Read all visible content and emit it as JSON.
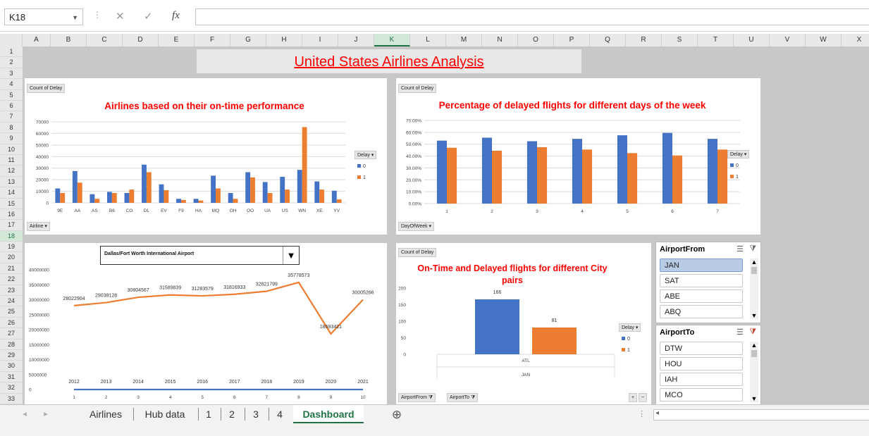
{
  "formula_bar": {
    "name_box": "K18",
    "fx_label": "fx",
    "formula_value": ""
  },
  "columns": [
    "A",
    "B",
    "C",
    "D",
    "E",
    "F",
    "G",
    "H",
    "I",
    "J",
    "K",
    "L",
    "M",
    "N",
    "O",
    "P",
    "Q",
    "R",
    "S",
    "T",
    "U",
    "V",
    "W",
    "X"
  ],
  "selected_column": "K",
  "rows": [
    "1",
    "2",
    "3",
    "4",
    "5",
    "6",
    "7",
    "8",
    "9",
    "10",
    "11",
    "12",
    "13",
    "14",
    "15",
    "16",
    "17",
    "18",
    "19",
    "20",
    "21",
    "22",
    "23",
    "24",
    "25",
    "26",
    "27",
    "28",
    "29",
    "30",
    "31",
    "32",
    "33"
  ],
  "selected_row": "18",
  "dashboard_title": "United States Airlines Analysis",
  "colors": {
    "series_0": "#4472c4",
    "series_1": "#ed7d31",
    "title_red": "#ff0000",
    "excel_green": "#217346"
  },
  "chart1": {
    "field_value": "Count of Delay",
    "field_axis": "Airline",
    "legend_title": "Delay",
    "legend": [
      "0",
      "1"
    ]
  },
  "chart2": {
    "field_value": "Count of Delay",
    "field_axis": "DayOfWeek",
    "legend_title": "Delay",
    "legend": [
      "0",
      "1"
    ]
  },
  "chart3": {
    "dropdown_value": "Dallas/Fort Worth International Airport"
  },
  "chart4": {
    "field_value": "Count of Delay",
    "legend_title": "Delay",
    "legend": [
      "0",
      "1"
    ],
    "filter_from": "AirportFrom",
    "filter_to": "AirportTo",
    "plus": "+",
    "minus": "−"
  },
  "chart_data": [
    {
      "type": "bar",
      "title": "Airlines based on their on-time performance",
      "categories": [
        "9E",
        "AA",
        "AS",
        "B6",
        "CO",
        "DL",
        "EV",
        "F9",
        "HA",
        "MQ",
        "OH",
        "OO",
        "UA",
        "US",
        "WN",
        "XE",
        "YV"
      ],
      "series": [
        {
          "name": "0",
          "values": [
            12500,
            27500,
            7500,
            9500,
            8500,
            33000,
            16000,
            3500,
            3500,
            23500,
            8500,
            26500,
            18000,
            22500,
            28500,
            18500,
            10500
          ]
        },
        {
          "name": "1",
          "values": [
            8500,
            17500,
            3500,
            8500,
            11500,
            26500,
            11000,
            2500,
            2000,
            12500,
            3500,
            22000,
            8500,
            11500,
            65500,
            11500,
            3000
          ]
        }
      ],
      "y_ticks": [
        "0",
        "10000",
        "20000",
        "30000",
        "40000",
        "50000",
        "60000",
        "70000"
      ],
      "ylim": [
        0,
        70000
      ]
    },
    {
      "type": "bar",
      "title": "Percentage of delayed flights for different days of the week",
      "categories": [
        "1",
        "2",
        "3",
        "4",
        "5",
        "6",
        "7"
      ],
      "series": [
        {
          "name": "0",
          "values": [
            0.53,
            0.555,
            0.525,
            0.545,
            0.575,
            0.595,
            0.545
          ]
        },
        {
          "name": "1",
          "values": [
            0.47,
            0.445,
            0.475,
            0.455,
            0.425,
            0.405,
            0.455
          ]
        }
      ],
      "y_ticks": [
        "0.00%",
        "10.00%",
        "20.00%",
        "30.00%",
        "40.00%",
        "50.00%",
        "60.00%",
        "70.00%"
      ],
      "ylim": [
        0,
        0.7
      ]
    },
    {
      "type": "line",
      "title": "",
      "x": [
        "1",
        "2",
        "3",
        "4",
        "5",
        "6",
        "7",
        "8",
        "9",
        "10"
      ],
      "series": [
        {
          "name": "Year",
          "values": [
            2012,
            2013,
            2014,
            2015,
            2016,
            2017,
            2018,
            2019,
            2020,
            2021
          ],
          "labels": [
            "2012",
            "2013",
            "2014",
            "2015",
            "2016",
            "2017",
            "2018",
            "2019",
            "2020",
            "2021"
          ]
        },
        {
          "name": "Passengers",
          "values": [
            28022904,
            29038128,
            30804567,
            31589839,
            31283579,
            31816933,
            32821799,
            35778573,
            18593421,
            30005266
          ],
          "labels": [
            "28022904",
            "29038128",
            "30804567",
            "31589839",
            "31283579",
            "31816933",
            "32821799",
            "35778573",
            "18593421",
            "30005266"
          ]
        }
      ],
      "y_ticks": [
        "0",
        "5000000",
        "10000000",
        "15000000",
        "20000000",
        "25000000",
        "30000000",
        "35000000",
        "40000000"
      ],
      "ylim": [
        0,
        40000000
      ]
    },
    {
      "type": "bar",
      "title": "On-Time and Delayed flights for different City pairs",
      "categories": [
        "ATL"
      ],
      "group_label": "JAN",
      "series": [
        {
          "name": "0",
          "values": [
            166
          ]
        },
        {
          "name": "1",
          "values": [
            81
          ]
        }
      ],
      "y_ticks": [
        "0",
        "50",
        "100",
        "150",
        "200"
      ],
      "ylim": [
        0,
        200
      ]
    }
  ],
  "slicer_from": {
    "title": "AirportFrom",
    "items": [
      "JAN",
      "SAT",
      "ABE",
      "ABQ"
    ],
    "selected": "JAN"
  },
  "slicer_to": {
    "title": "AirportTo",
    "items": [
      "DTW",
      "HOU",
      "IAH",
      "MCO"
    ]
  },
  "sheet_tabs": [
    "Airlines",
    "Hub data",
    "1",
    "2",
    "3",
    "4",
    "Dashboard"
  ],
  "active_tab": "Dashboard",
  "add_sheet": "⊕"
}
